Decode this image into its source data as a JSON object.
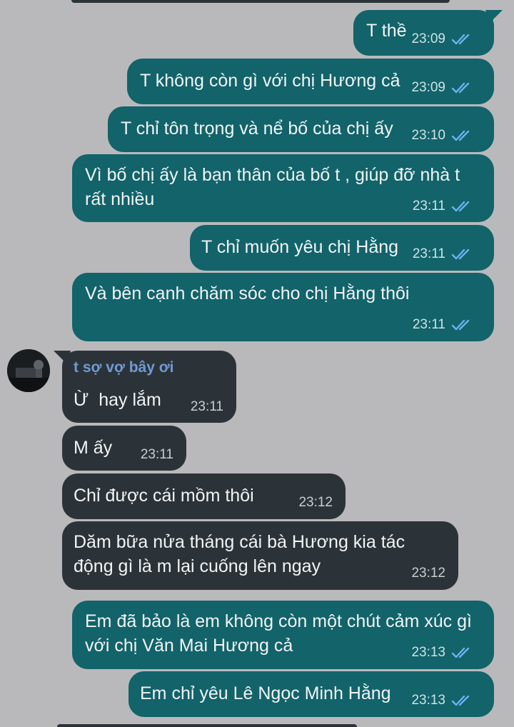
{
  "messages": [
    {
      "id": "m1",
      "dir": "out",
      "text": "T thề",
      "time": "23:09"
    },
    {
      "id": "m2",
      "dir": "out",
      "text": "T không còn gì với chị Hương cả",
      "time": "23:09"
    },
    {
      "id": "m3",
      "dir": "out",
      "text": "T chỉ tôn trọng và nể bố của chị ấy",
      "time": "23:10"
    },
    {
      "id": "m4",
      "dir": "out",
      "text": "Vì bố chị ấy là bạn thân của bố t , giúp đỡ nhà t rất nhiều",
      "time": "23:11"
    },
    {
      "id": "m5",
      "dir": "out",
      "text": "T chỉ muốn yêu chị Hằng",
      "time": "23:11"
    },
    {
      "id": "m6",
      "dir": "out",
      "text": "Và bên cạnh chăm sóc cho chị Hằng thôi",
      "time": "23:11"
    },
    {
      "id": "m7",
      "dir": "in",
      "sender": "t sợ vợ bây ơi",
      "text": "Ừ  hay lắm",
      "time": "23:11"
    },
    {
      "id": "m8",
      "dir": "in",
      "text": "M ấy",
      "time": "23:11"
    },
    {
      "id": "m9",
      "dir": "in",
      "text": "Chỉ được cái mồm thôi",
      "time": "23:12"
    },
    {
      "id": "m10",
      "dir": "in",
      "text": "Dăm bữa nửa tháng cái bà Hương kia tác động gì là m lại cuống lên ngay",
      "time": "23:12"
    },
    {
      "id": "m11",
      "dir": "out",
      "text": "Em đã bảo là em không còn một chút cảm xúc gì với chị Văn Mai Hương cả",
      "time": "23:13"
    },
    {
      "id": "m12",
      "dir": "out",
      "text": "Em chỉ yêu Lê Ngọc Minh Hằng",
      "time": "23:13"
    }
  ],
  "icons": {
    "read_receipt": "double-check-icon",
    "avatar": "contact-avatar"
  },
  "colors": {
    "background": "#b9b9bb",
    "outgoing_bubble": "#12636a",
    "incoming_bubble": "#2c3338",
    "sender_name": "#6f9bd6",
    "read_tick": "#6ab2f2"
  }
}
